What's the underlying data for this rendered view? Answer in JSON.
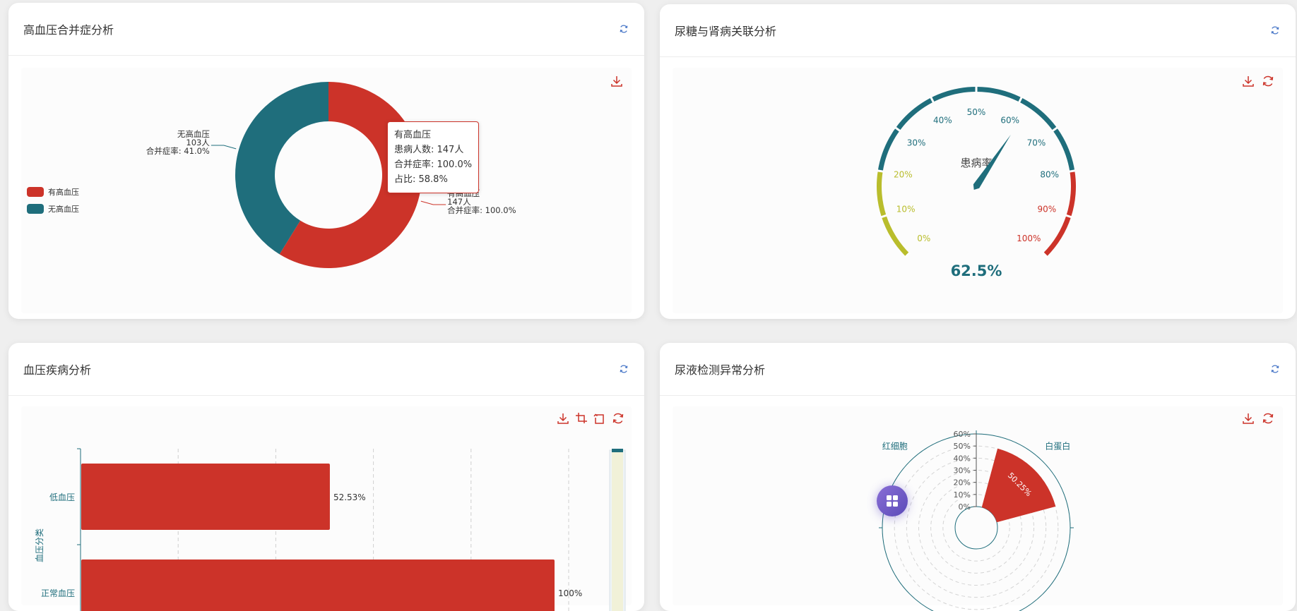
{
  "cards": {
    "hypertension": {
      "title": "高血压合并症分析"
    },
    "diabetes": {
      "title": "尿糖与肾病关联分析"
    },
    "bloodpressure": {
      "title": "血压疾病分析"
    },
    "urine": {
      "title": "尿液检测异常分析"
    }
  },
  "colors": {
    "red": "#cc3329",
    "teal": "#1f6e7c",
    "olive": "#b9bd2c"
  },
  "icons": {
    "refresh": "refresh-icon",
    "download": "download-icon",
    "zoom": "zoom-icon",
    "zoom_reset": "zoom-reset-icon",
    "restore": "restore-icon",
    "fab": "grid-icon"
  },
  "chart_data": [
    {
      "type": "pie",
      "variant": "donut",
      "legend": [
        "有高血压",
        "无高血压"
      ],
      "slices": [
        {
          "name": "有高血压",
          "value": 147,
          "label_lines": [
            "有高血压",
            "147人",
            "合并症率: 100.0%"
          ],
          "color": "#cc3329"
        },
        {
          "name": "无高血压",
          "value": 103,
          "label_lines": [
            "无高血压",
            "103人",
            "合并症率: 41.0%"
          ],
          "color": "#1f6e7c"
        }
      ],
      "tooltip": {
        "title": "有高血压",
        "lines": [
          "患病人数: 147人",
          "合并症率: 100.0%",
          "占比: 58.8%"
        ]
      }
    },
    {
      "type": "gauge",
      "min": 0,
      "max": 100,
      "value": 62.5,
      "value_label": "62.5%",
      "name": "患病率",
      "ticks": [
        "0%",
        "10%",
        "20%",
        "30%",
        "40%",
        "50%",
        "60%",
        "70%",
        "80%",
        "90%",
        "100%"
      ],
      "bands": [
        {
          "to": 0.2,
          "color": "#b9bd2c"
        },
        {
          "to": 0.8,
          "color": "#1f6e7c"
        },
        {
          "to": 1.0,
          "color": "#cc3329"
        }
      ]
    },
    {
      "type": "bar",
      "orientation": "horizontal",
      "ylabel": "血压分类",
      "categories": [
        "低血压",
        "正常血压"
      ],
      "values": [
        52.53,
        100
      ],
      "value_labels": [
        "52.53%",
        "100%"
      ],
      "xlim": [
        0,
        100
      ],
      "color": "#cc3329"
    },
    {
      "type": "bar",
      "variant": "polar",
      "categories": [
        "红细胞",
        "白蛋白"
      ],
      "values": [
        0,
        50.25
      ],
      "value_label": "50.25%",
      "radial_ticks": [
        "0%",
        "10%",
        "20%",
        "30%",
        "40%",
        "50%",
        "60%"
      ],
      "rlim": [
        0,
        60
      ],
      "color": "#cc3329"
    }
  ]
}
